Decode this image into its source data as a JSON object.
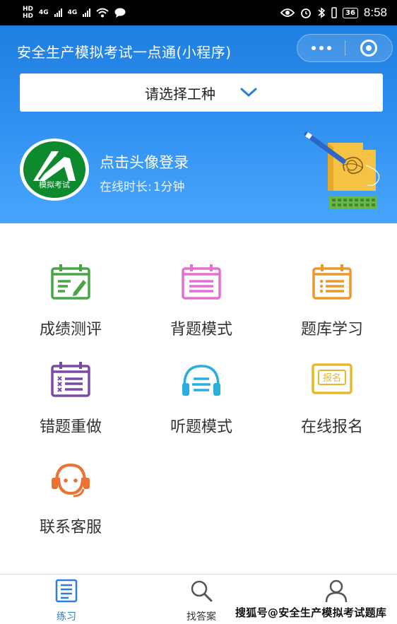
{
  "status_bar": {
    "net_label_1": "HD",
    "net_label_2": "HD",
    "signal_1": "4G",
    "signal_2": "4G",
    "battery": "36",
    "time": "8:58"
  },
  "header": {
    "title": "安全生产模拟考试一点通(小程序)",
    "select_placeholder": "请选择工种",
    "login_text": "点击头像登录",
    "online_label": "在线时长:",
    "online_value": "1分钟",
    "avatar_caption": "模拟考试"
  },
  "menu": [
    {
      "label": "成绩测评",
      "icon": "score-evaluation-icon",
      "color": "#4aa548"
    },
    {
      "label": "背题模式",
      "icon": "memorize-mode-icon",
      "color": "#e46fd3"
    },
    {
      "label": "题库学习",
      "icon": "question-bank-icon",
      "color": "#e99a2c"
    },
    {
      "label": "错题重做",
      "icon": "wrong-questions-icon",
      "color": "#7a4aa8"
    },
    {
      "label": "听题模式",
      "icon": "listen-mode-icon",
      "color": "#2aaee0"
    },
    {
      "label": "在线报名",
      "icon": "online-registration-icon",
      "color": "#e6b92a",
      "badge": "报名"
    },
    {
      "label": "联系客服",
      "icon": "customer-service-icon",
      "color": "#ea7232"
    }
  ],
  "tabbar": {
    "tabs": [
      {
        "label": "练习",
        "active": true
      },
      {
        "label": "找答案",
        "active": false
      },
      {
        "label": "我的",
        "active": false
      }
    ]
  },
  "watermark": "搜狐号@安全生产模拟考试题库",
  "colors": {
    "header_blue": "#2f8ff0",
    "avatar_green": "#0d8a2e",
    "active_tab": "#2a7fd8"
  }
}
